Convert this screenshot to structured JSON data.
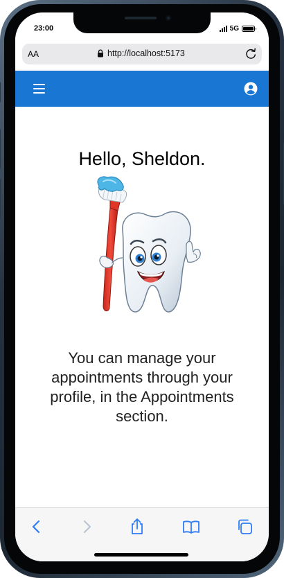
{
  "status_bar": {
    "time": "23:00",
    "network": "5G",
    "signal_icon": "signal-bars-icon",
    "battery_icon": "battery-icon"
  },
  "browser": {
    "text_size_label": "AA",
    "url": "http://localhost:5173",
    "lock_icon": "lock-icon",
    "reload_icon": "reload-icon"
  },
  "app_bar": {
    "color": "#1976d2",
    "menu_icon": "hamburger-menu-icon",
    "account_icon": "account-circle-icon"
  },
  "main": {
    "greeting": "Hello, Sheldon.",
    "mascot": "tooth-with-toothbrush-illustration",
    "message": "You can manage your appointments through your profile, in the Appointments section."
  },
  "toolbar": {
    "accent_color": "#2f7cf6",
    "disabled_color": "#b9c3d1",
    "icons": [
      "back-icon",
      "forward-icon",
      "share-icon",
      "bookmarks-icon",
      "tabs-icon"
    ]
  }
}
